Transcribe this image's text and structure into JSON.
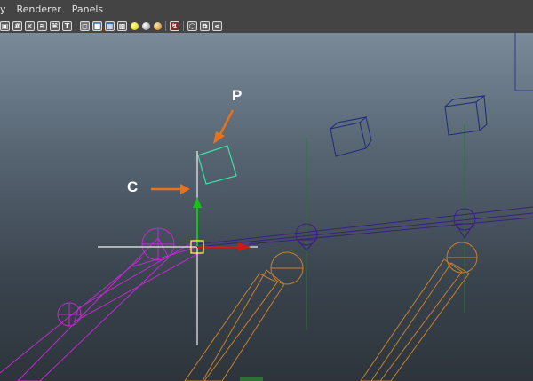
{
  "menu": {
    "item_view_partial": "y",
    "item_renderer": "Renderer",
    "item_panels": "Panels"
  },
  "toolbar": {
    "icons": [
      "camera-icon",
      "grid-icon",
      "select-icon",
      "xray-icon",
      "joint-xray-icon",
      "texture-T-icon",
      "wireframe-cube-icon",
      "shaded-cube-icon",
      "textured-cube-icon",
      "checker-cube-icon",
      "light-ball-icon",
      "shadow-ball-icon",
      "material-ball-icon",
      "isolate-select-icon",
      "cube-view-icon",
      "multi-cube-icon",
      "share-icon"
    ],
    "texture_letter": "T"
  },
  "viewport": {
    "annotation_p": "P",
    "annotation_c": "C",
    "accent_orange": "#e8721c",
    "selection_yellow": "#ffff33",
    "joint_magenta": "#c02ad0",
    "ik_blue": "#2a2a7a",
    "bone_orange": "#c5802e",
    "axis_green": "#2e7d3a"
  }
}
